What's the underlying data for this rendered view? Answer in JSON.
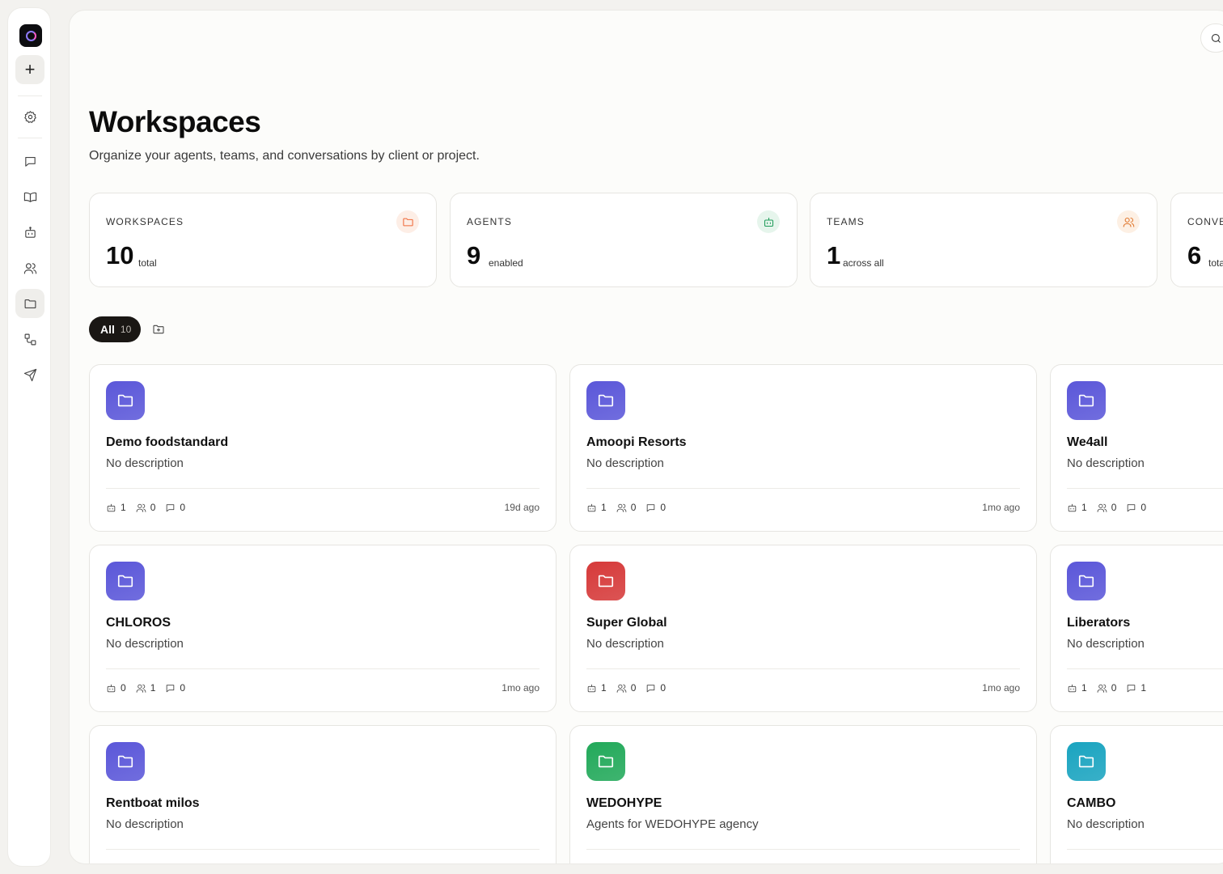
{
  "page": {
    "title": "Workspaces",
    "subtitle": "Organize your agents, teams, and conversations by client or project."
  },
  "sidebar": {
    "add_label": "+",
    "items": [
      {
        "name": "settings",
        "icon": "gear-icon"
      },
      {
        "name": "chats",
        "icon": "chat-icon"
      },
      {
        "name": "knowledge",
        "icon": "book-icon"
      },
      {
        "name": "agents",
        "icon": "robot-icon"
      },
      {
        "name": "teams",
        "icon": "users-icon"
      },
      {
        "name": "workspaces",
        "icon": "folder-icon",
        "active": true
      },
      {
        "name": "workflows",
        "icon": "workflow-icon"
      },
      {
        "name": "send",
        "icon": "send-icon"
      }
    ]
  },
  "stats": [
    {
      "label": "WORKSPACES",
      "value": "10",
      "unit": "total",
      "icon": "folder-icon",
      "color": "#ef6a3a"
    },
    {
      "label": "AGENTS",
      "value": "9",
      "unit": "enabled",
      "icon": "robot-icon",
      "color": "#1f9c5a"
    },
    {
      "label": "TEAMS",
      "value": "1",
      "unit": "across all",
      "icon": "users-icon",
      "color": "#e0762c"
    },
    {
      "label": "CONVE",
      "value": "6",
      "unit": "tota",
      "icon": "chat-icon",
      "color": "#6b5be8"
    }
  ],
  "filters": {
    "all_label": "All",
    "all_count": "10"
  },
  "workspaces": [
    {
      "name": "Demo foodstandard",
      "description": "No description",
      "agents": "1",
      "teams": "0",
      "conversations": "0",
      "updated": "19d ago",
      "color": "#5b57d9"
    },
    {
      "name": "Amoopi Resorts",
      "description": "No description",
      "agents": "1",
      "teams": "0",
      "conversations": "0",
      "updated": "1mo ago",
      "color": "#5b57d9"
    },
    {
      "name": "We4all",
      "description": "No description",
      "agents": "1",
      "teams": "0",
      "conversations": "0",
      "updated": "",
      "color": "#5b57d9"
    },
    {
      "name": "CHLOROS",
      "description": "No description",
      "agents": "0",
      "teams": "1",
      "conversations": "0",
      "updated": "1mo ago",
      "color": "#5b57d9"
    },
    {
      "name": "Super Global",
      "description": "No description",
      "agents": "1",
      "teams": "0",
      "conversations": "0",
      "updated": "1mo ago",
      "color": "#d63a3a"
    },
    {
      "name": "Liberators",
      "description": "No description",
      "agents": "1",
      "teams": "0",
      "conversations": "1",
      "updated": "",
      "color": "#5b57d9"
    },
    {
      "name": "Rentboat milos",
      "description": "No description",
      "agents": "",
      "teams": "",
      "conversations": "",
      "updated": "",
      "color": "#5b57d9"
    },
    {
      "name": "WEDOHYPE",
      "description": "Agents for WEDOHYPE agency",
      "agents": "",
      "teams": "",
      "conversations": "",
      "updated": "",
      "color": "#22a95a"
    },
    {
      "name": "CAMBO",
      "description": "No description",
      "agents": "",
      "teams": "",
      "conversations": "",
      "updated": "",
      "color": "#1aa4c0"
    }
  ]
}
